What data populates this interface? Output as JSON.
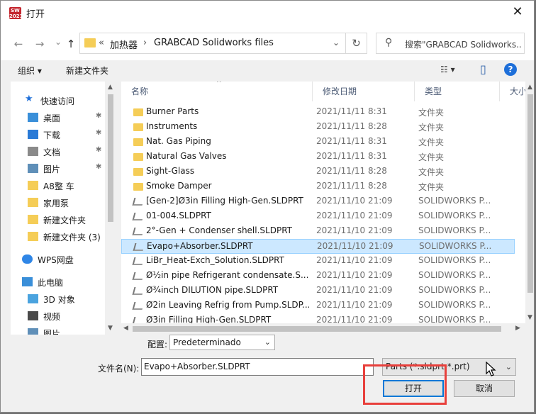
{
  "titlebar": {
    "title": "打开",
    "app_icon_text": "SW 2021",
    "close": "✕"
  },
  "nav": {
    "back": "←",
    "forward": "→",
    "dropdown": "⌄",
    "up": "↑",
    "breadcrumb": [
      "«",
      "加热器",
      "›",
      "GRABCAD Solidworks files",
      "⌄"
    ],
    "refresh": "↻",
    "search_placeholder": "搜索\"GRABCAD Solidworks..."
  },
  "toolbar": {
    "organize": "组织 ▾",
    "new_folder": "新建文件夹",
    "view_icon": "☷ ▾",
    "pane_icon": "▯",
    "help": "?"
  },
  "sidebar": {
    "items": [
      {
        "label": "快速访问",
        "icon": "star-icon",
        "color": "#1e6fd9",
        "pinned": false
      },
      {
        "label": "桌面",
        "icon": "desktop-icon",
        "color": "#3a8fd9",
        "pinned": true
      },
      {
        "label": "下载",
        "icon": "download-icon",
        "color": "#2a7ad6",
        "pinned": true
      },
      {
        "label": "文档",
        "icon": "document-icon",
        "color": "#8a8a8a",
        "pinned": true
      },
      {
        "label": "图片",
        "icon": "pictures-icon",
        "color": "#5f8fb8",
        "pinned": true
      },
      {
        "label": "A8整 车",
        "icon": "folder-icon",
        "color": "#f5cd57",
        "pinned": false
      },
      {
        "label": "家用泵",
        "icon": "folder-icon",
        "color": "#f5cd57",
        "pinned": false
      },
      {
        "label": "新建文件夹",
        "icon": "folder-icon",
        "color": "#f5cd57",
        "pinned": false
      },
      {
        "label": "新建文件夹 (3)",
        "icon": "folder-icon",
        "color": "#f5cd57",
        "pinned": false
      },
      {
        "label": "WPS网盘",
        "icon": "cloud-icon",
        "color": "#2f86e6",
        "pinned": false
      },
      {
        "label": "此电脑",
        "icon": "computer-icon",
        "color": "#3a8fd9",
        "pinned": false
      },
      {
        "label": "3D 对象",
        "icon": "3d-objects-icon",
        "color": "#4aa3df",
        "pinned": false
      },
      {
        "label": "视频",
        "icon": "video-icon",
        "color": "#4a4a4a",
        "pinned": false
      },
      {
        "label": "图片",
        "icon": "pictures-icon",
        "color": "#5f8fb8",
        "pinned": false
      }
    ],
    "pin_glyph": "📌"
  },
  "columns": {
    "name": "名称",
    "modified": "修改日期",
    "type": "类型",
    "size": "大小"
  },
  "files": [
    {
      "name": "Burner Parts",
      "date": "2021/11/11 8:31",
      "type": "文件夹",
      "kind": "folder",
      "selected": false
    },
    {
      "name": "Instruments",
      "date": "2021/11/11 8:28",
      "type": "文件夹",
      "kind": "folder",
      "selected": false
    },
    {
      "name": "Nat. Gas Piping",
      "date": "2021/11/11 8:31",
      "type": "文件夹",
      "kind": "folder",
      "selected": false
    },
    {
      "name": "Natural Gas Valves",
      "date": "2021/11/11 8:31",
      "type": "文件夹",
      "kind": "folder",
      "selected": false
    },
    {
      "name": "Sight-Glass",
      "date": "2021/11/11 8:28",
      "type": "文件夹",
      "kind": "folder",
      "selected": false
    },
    {
      "name": "Smoke Damper",
      "date": "2021/11/11 8:28",
      "type": "文件夹",
      "kind": "folder",
      "selected": false
    },
    {
      "name": "[Gen-2]Ø3in Filling High-Gen.SLDPRT",
      "date": "2021/11/10 21:09",
      "type": "SOLIDWORKS P...",
      "kind": "part",
      "selected": false
    },
    {
      "name": "01-004.SLDPRT",
      "date": "2021/11/10 21:09",
      "type": "SOLIDWORKS P...",
      "kind": "part",
      "selected": false
    },
    {
      "name": "2°-Gen + Condenser shell.SLDPRT",
      "date": "2021/11/10 21:09",
      "type": "SOLIDWORKS P...",
      "kind": "part",
      "selected": false
    },
    {
      "name": "Evapo+Absorber.SLDPRT",
      "date": "2021/11/10 21:09",
      "type": "SOLIDWORKS P...",
      "kind": "part",
      "selected": true
    },
    {
      "name": "LiBr_Heat-Exch_Solution.SLDPRT",
      "date": "2021/11/10 21:09",
      "type": "SOLIDWORKS P...",
      "kind": "part",
      "selected": false
    },
    {
      "name": "Ø½in pipe Refrigerant condensate.S...",
      "date": "2021/11/10 21:09",
      "type": "SOLIDWORKS P...",
      "kind": "part",
      "selected": false
    },
    {
      "name": "Ø¾inch DILUTION pipe.SLDPRT",
      "date": "2021/11/10 21:09",
      "type": "SOLIDWORKS P...",
      "kind": "part",
      "selected": false
    },
    {
      "name": "Ø2in Leaving Refrig from Pump.SLDP...",
      "date": "2021/11/10 21:09",
      "type": "SOLIDWORKS P...",
      "kind": "part",
      "selected": false
    },
    {
      "name": "Ø3in Filling High-Gen.SLDPRT",
      "date": "2021/11/10 21:09",
      "type": "SOLIDWORKS P...",
      "kind": "part",
      "selected": false
    }
  ],
  "bottom": {
    "config_label": "配置:",
    "config_value": "Predeterminado",
    "filename_label": "文件名(N):",
    "filename_value": "Evapo+Absorber.SLDPRT",
    "filter_value": "Parts (*.sldprt;*.prt)",
    "open": "打开",
    "cancel": "取消"
  },
  "colors": {
    "accent": "#0078d7",
    "selection": "#cce8ff",
    "folder": "#f5cd57",
    "annotation": "#e8403c"
  }
}
